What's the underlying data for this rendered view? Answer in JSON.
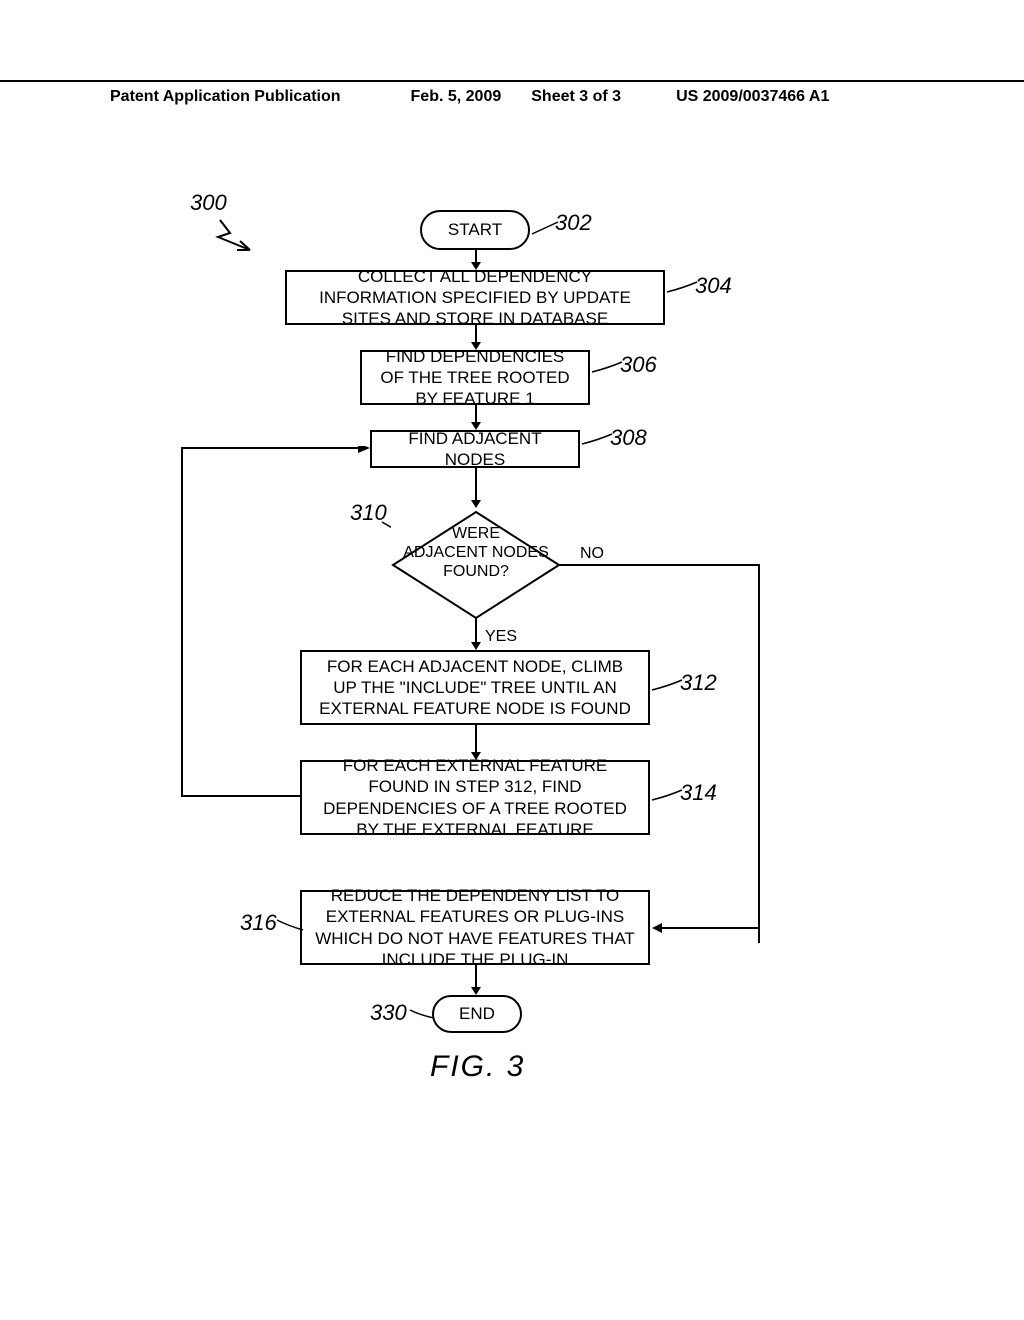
{
  "header": {
    "pub_label": "Patent Application Publication",
    "pub_date": "Feb. 5, 2009",
    "sheet": "Sheet 3 of 3",
    "doc_number": "US 2009/0037466 A1"
  },
  "labels": {
    "l300": "300",
    "l302": "302",
    "l304": "304",
    "l306": "306",
    "l308": "308",
    "l310": "310",
    "l312": "312",
    "l314": "314",
    "l316": "316",
    "l330": "330"
  },
  "nodes": {
    "start": "START",
    "step304": "COLLECT ALL DEPENDENCY INFORMATION SPECIFIED BY UPDATE SITES AND STORE IN DATABASE",
    "step306": "FIND DEPENDENCIES OF THE TREE ROOTED BY FEATURE 1",
    "step308": "FIND ADJACENT NODES",
    "decision310_l1": "WERE",
    "decision310_l2": "ADJACENT NODES",
    "decision310_l3": "FOUND?",
    "step312": "FOR EACH ADJACENT NODE, CLIMB UP THE \"INCLUDE\" TREE UNTIL AN EXTERNAL FEATURE NODE IS FOUND",
    "step314": "FOR EACH EXTERNAL FEATURE FOUND IN STEP 312, FIND DEPENDENCIES OF A TREE ROOTED BY THE EXTERNAL FEATURE",
    "step316": "REDUCE THE DEPENDENY LIST TO EXTERNAL FEATURES OR PLUG-INS WHICH DO NOT HAVE FEATURES THAT INCLUDE THE PLUG-IN",
    "end": "END"
  },
  "edge_labels": {
    "yes": "YES",
    "no": "NO"
  },
  "figure_caption": "FIG. 3"
}
